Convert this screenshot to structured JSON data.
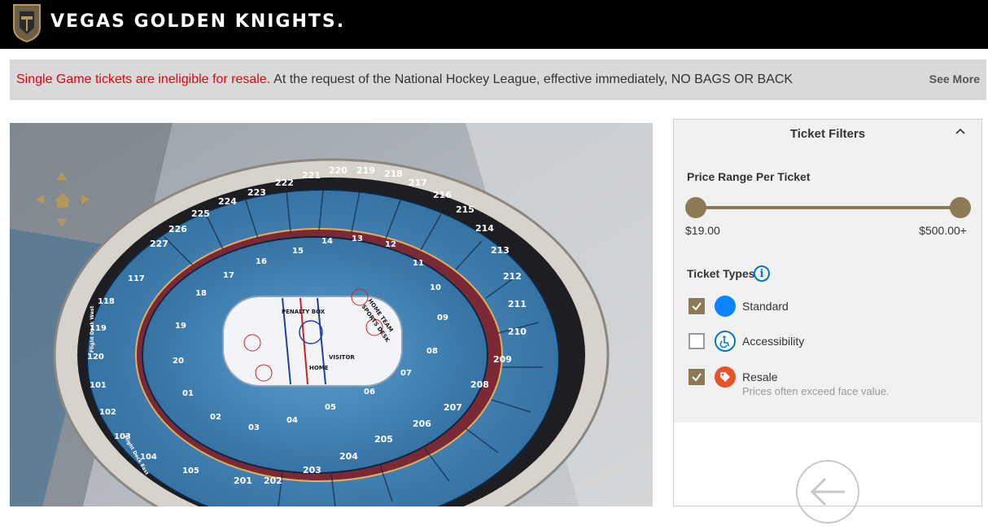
{
  "header": {
    "brand": "VEGAS GOLDEN KNIGHTS.",
    "logo_icon": "knight-helmet-shield-icon"
  },
  "alert": {
    "highlight": "Single Game tickets are ineligible for resale.",
    "message": "At the request of the National Hockey League, effective immediately, NO BAGS OR BACK",
    "see_more": "See More"
  },
  "map": {
    "penalty_box": "PENALTY BOX",
    "home_team": "HOME TEAM",
    "sports_desk": "SPORTS DESK",
    "home": "HOME",
    "visitor": "VISITOR",
    "flight_deck_west": "Flight Deck West",
    "flight_deck_east": "Flight Deck East",
    "sections_upper": [
      "227",
      "226",
      "225",
      "224",
      "223",
      "222",
      "221",
      "220",
      "219",
      "218",
      "217",
      "216",
      "215",
      "214",
      "213",
      "212",
      "211",
      "210",
      "209",
      "208",
      "207",
      "206",
      "205",
      "204",
      "203",
      "202",
      "201"
    ],
    "sections_lower": [
      "117",
      "118",
      "119",
      "120",
      "101",
      "102",
      "103",
      "104",
      "105",
      "18",
      "17",
      "16",
      "15",
      "14",
      "13",
      "12",
      "11",
      "10",
      "09",
      "08",
      "07",
      "06",
      "05",
      "04",
      "03",
      "02",
      "01",
      "20",
      "19"
    ]
  },
  "filters": {
    "title": "Ticket Filters",
    "price_label": "Price Range Per Ticket",
    "price_min": "$19.00",
    "price_max": "$500.00+",
    "types_label": "Ticket Types",
    "types": [
      {
        "label": "Standard",
        "checked": true,
        "icon": "standard-dot-icon",
        "color": "#0a84ff"
      },
      {
        "label": "Accessibility",
        "checked": false,
        "icon": "wheelchair-icon",
        "color": "#0077c8"
      },
      {
        "label": "Resale",
        "sub": "Prices often exceed face value.",
        "checked": true,
        "icon": "tag-icon",
        "color": "#e8542a"
      }
    ],
    "accent": "#8c7a57"
  }
}
